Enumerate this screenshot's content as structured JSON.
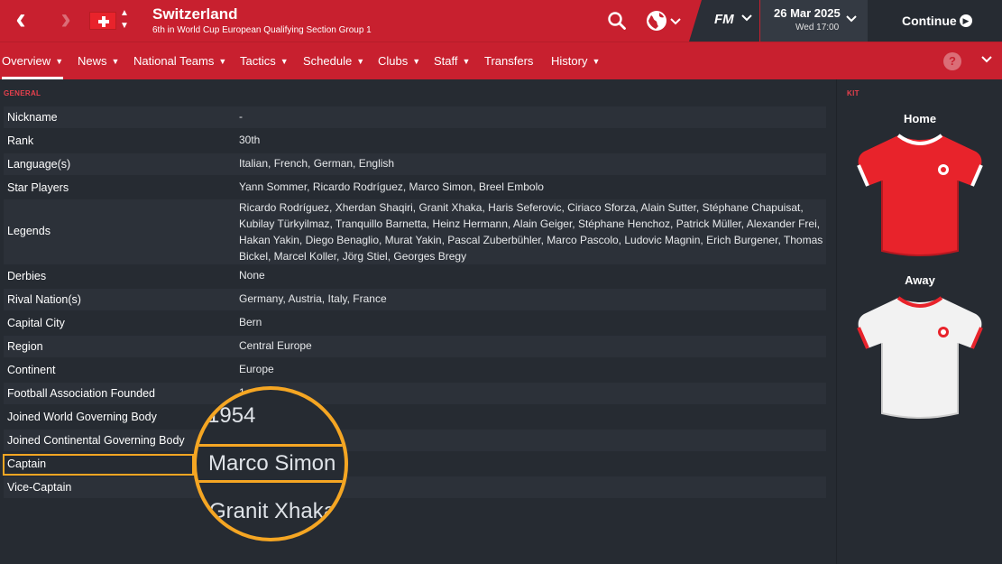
{
  "header": {
    "title": "Switzerland",
    "subtitle": "6th in World Cup European Qualifying Section Group 1",
    "fm_logo": "FM",
    "date": "26 Mar 2025",
    "time": "Wed 17:00",
    "continue_label": "Continue"
  },
  "menu": [
    {
      "label": "Overview",
      "caret": "⌄"
    },
    {
      "label": "News",
      "caret": "⌄"
    },
    {
      "label": "National Teams",
      "caret": "⌄"
    },
    {
      "label": "Tactics",
      "caret": "⌄"
    },
    {
      "label": "Schedule",
      "caret": "⌄"
    },
    {
      "label": "Clubs",
      "caret": "⌄"
    },
    {
      "label": "Staff",
      "caret": "⌄"
    },
    {
      "label": "Transfers"
    },
    {
      "label": "History",
      "caret": "⌄"
    }
  ],
  "general": {
    "section_label": "GENERAL",
    "rows": [
      {
        "label": "Nickname",
        "value": "-"
      },
      {
        "label": "Rank",
        "value": "30th"
      },
      {
        "label": "Language(s)",
        "value": "Italian, French, German, English"
      },
      {
        "label": "Star Players",
        "value": "Yann Sommer, Ricardo Rodríguez, Marco Simon, Breel Embolo"
      },
      {
        "label": "Legends",
        "value": "Ricardo Rodríguez, Xherdan Shaqiri, Granit Xhaka, Haris Seferovic, Ciriaco Sforza, Alain Sutter, Stéphane Chapuisat, Kubilay Türkyilmaz, Tranquillo Barnetta, Heinz Hermann, Alain Geiger, Stéphane Henchoz, Patrick Müller, Alexander Frei, Hakan Yakin, Diego Benaglio, Murat Yakin, Pascal Zuberbühler, Marco Pascolo, Ludovic Magnin, Erich Burgener, Thomas Bickel, Marcel Koller, Jörg Stiel, Georges Bregy"
      },
      {
        "label": "Derbies",
        "value": "None"
      },
      {
        "label": "Rival Nation(s)",
        "value": "Germany, Austria, Italy, France"
      },
      {
        "label": "Capital City",
        "value": "Bern"
      },
      {
        "label": "Region",
        "value": "Central Europe"
      },
      {
        "label": "Continent",
        "value": "Europe"
      },
      {
        "label": "Football Association Founded",
        "value": "1"
      },
      {
        "label": "Joined World Governing Body",
        "value": ""
      },
      {
        "label": "Joined Continental Governing Body",
        "value": ""
      },
      {
        "label": "Captain",
        "value": ""
      },
      {
        "label": "Vice-Captain",
        "value": ""
      }
    ]
  },
  "kit": {
    "section_label": "KIT",
    "home_label": "Home",
    "away_label": "Away",
    "home_color": "#e8232b",
    "away_color": "#f2f2f2"
  },
  "magnifier": {
    "year": "1954",
    "captain": "Marco Simon",
    "vice_captain": "Granit Xhaka"
  },
  "colors": {
    "brand_red": "#c8202f",
    "background": "#262b32",
    "highlight": "#f5a623",
    "section_label": "#e8404d"
  }
}
